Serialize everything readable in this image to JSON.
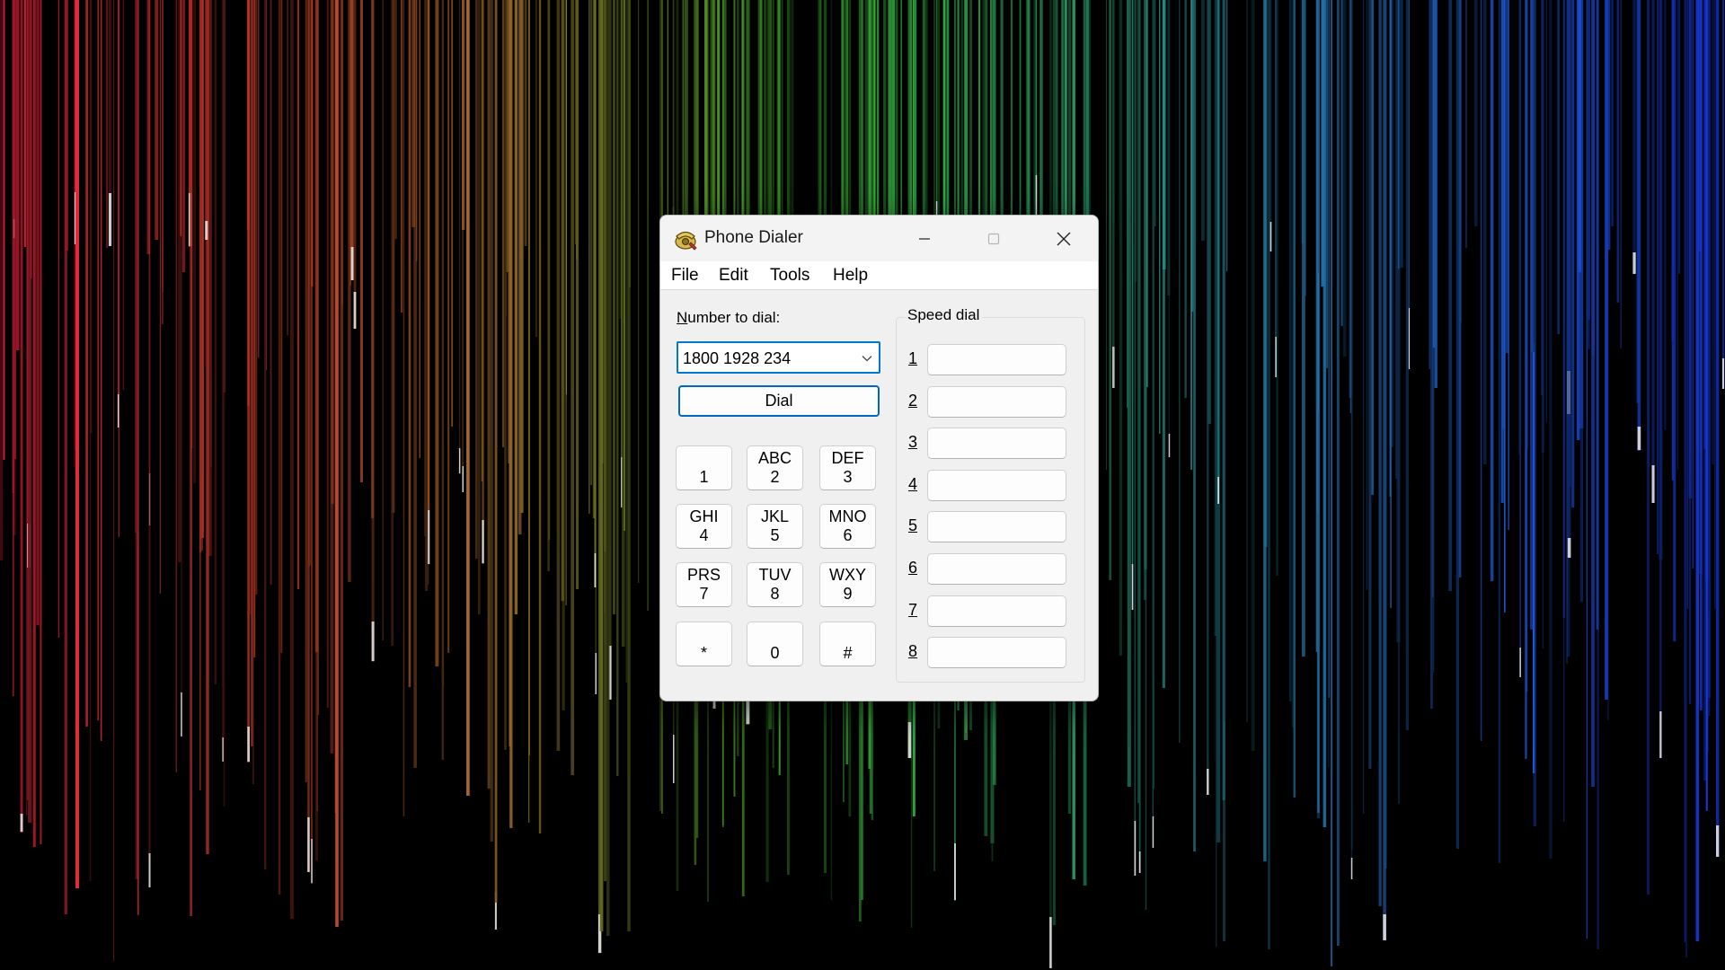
{
  "window": {
    "title": "Phone Dialer",
    "icon": "telephone-icon"
  },
  "titlebar": {
    "minimize_icon": "minimize-icon",
    "maximize_icon": "maximize-icon",
    "close_icon": "close-icon"
  },
  "menu": [
    "File",
    "Edit",
    "Tools",
    "Help"
  ],
  "number_to_dial": {
    "label": "Number to dial:",
    "value": "1800 1928 234"
  },
  "dial_button": "Dial",
  "keypad": [
    {
      "letters": "",
      "digit": "1"
    },
    {
      "letters": "ABC",
      "digit": "2"
    },
    {
      "letters": "DEF",
      "digit": "3"
    },
    {
      "letters": "GHI",
      "digit": "4"
    },
    {
      "letters": "JKL",
      "digit": "5"
    },
    {
      "letters": "MNO",
      "digit": "6"
    },
    {
      "letters": "PRS",
      "digit": "7"
    },
    {
      "letters": "TUV",
      "digit": "8"
    },
    {
      "letters": "WXY",
      "digit": "9"
    },
    {
      "letters": "",
      "digit": "*"
    },
    {
      "letters": "",
      "digit": "0"
    },
    {
      "letters": "",
      "digit": "#"
    }
  ],
  "speed_dial": {
    "title": "Speed dial",
    "items": [
      {
        "num": "1",
        "value": ""
      },
      {
        "num": "2",
        "value": ""
      },
      {
        "num": "3",
        "value": ""
      },
      {
        "num": "4",
        "value": ""
      },
      {
        "num": "5",
        "value": ""
      },
      {
        "num": "6",
        "value": ""
      },
      {
        "num": "7",
        "value": ""
      },
      {
        "num": "8",
        "value": ""
      }
    ]
  }
}
